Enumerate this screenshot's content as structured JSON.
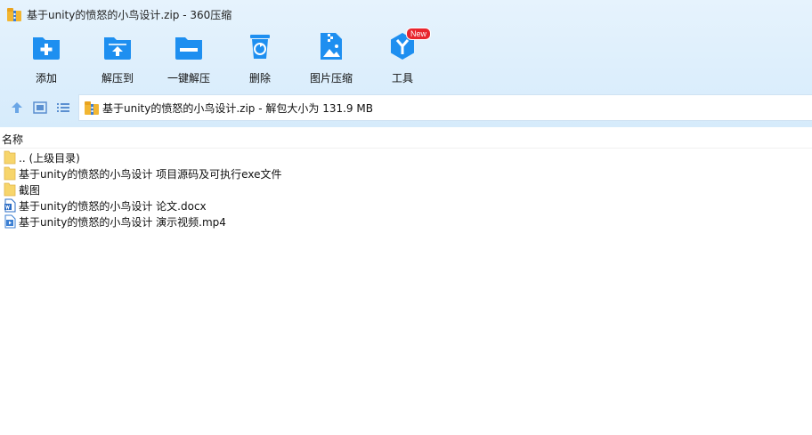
{
  "window": {
    "title": "基于unity的愤怒的小鸟设计.zip - 360压缩",
    "app_icon": "zip-archive-icon"
  },
  "toolbar": {
    "items": [
      {
        "label": "添加",
        "icon": "add-icon"
      },
      {
        "label": "解压到",
        "icon": "extract-to-icon"
      },
      {
        "label": "一键解压",
        "icon": "one-click-extract-icon"
      },
      {
        "label": "删除",
        "icon": "delete-icon"
      },
      {
        "label": "图片压缩",
        "icon": "image-compress-icon"
      },
      {
        "label": "工具",
        "icon": "tools-icon",
        "badge": "New"
      }
    ]
  },
  "navbar": {
    "buttons": [
      "up-icon",
      "thumbnail-view-icon",
      "list-view-icon"
    ],
    "address": "基于unity的愤怒的小鸟设计.zip - 解包大小为 131.9 MB"
  },
  "list": {
    "columns": [
      "名称"
    ],
    "rows": [
      {
        "name": ".. (上级目录)",
        "icon": "folder-icon"
      },
      {
        "name": "基于unity的愤怒的小鸟设计 项目源码及可执行exe文件",
        "icon": "folder-icon"
      },
      {
        "name": "截图",
        "icon": "folder-icon"
      },
      {
        "name": "基于unity的愤怒的小鸟设计 论文.docx",
        "icon": "word-doc-icon"
      },
      {
        "name": "基于unity的愤怒的小鸟设计 演示视频.mp4",
        "icon": "video-file-icon"
      }
    ]
  },
  "colors": {
    "accent": "#1e8ff0",
    "toolbar_bg": "#dceefc",
    "badge": "#e8262e"
  }
}
